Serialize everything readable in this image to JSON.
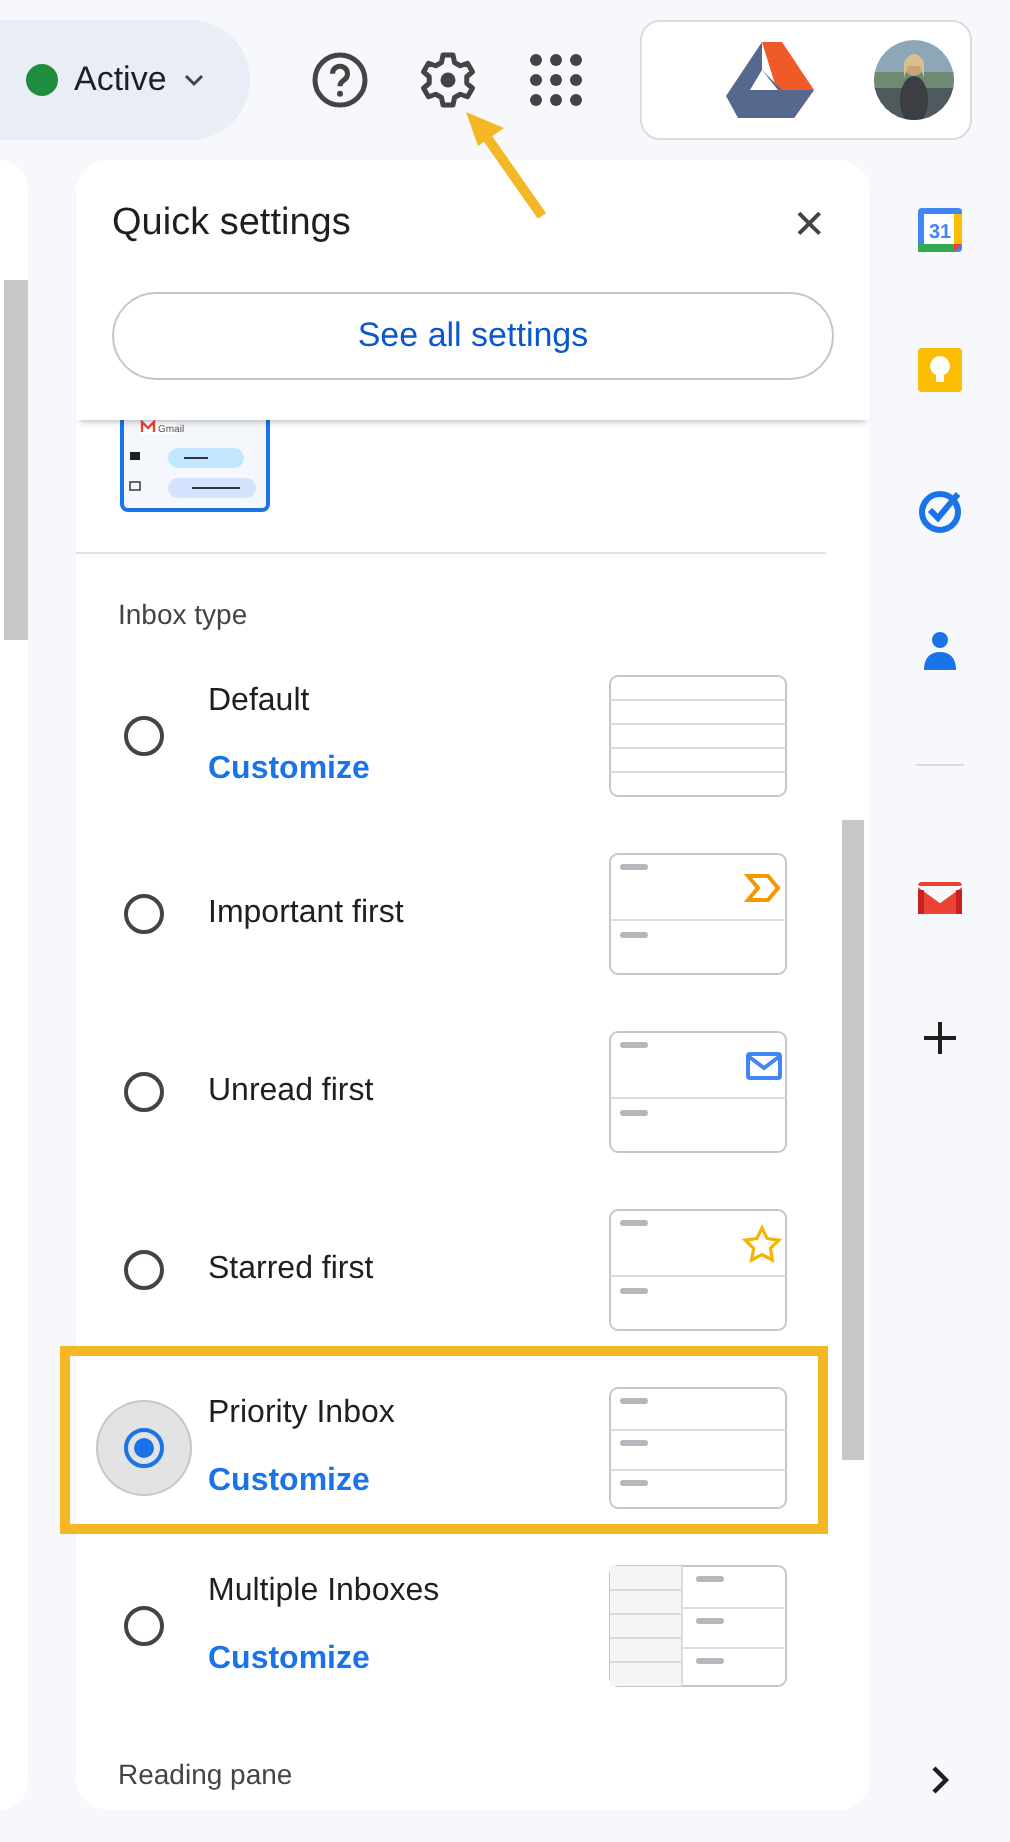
{
  "topbar": {
    "status": {
      "label": "Active",
      "color": "#1e8e3e"
    }
  },
  "quick_settings": {
    "title": "Quick settings",
    "close": "✕",
    "see_all_button": "See all settings",
    "density_thumbnail": {
      "brand": "Gmail"
    },
    "sections": [
      {
        "title": "Inbox type",
        "options": [
          {
            "label": "Default",
            "link": "Customize",
            "selected": false,
            "kind": "lines",
            "highlighted": false
          },
          {
            "label": "Important first",
            "selected": false,
            "kind": "important",
            "highlighted": false
          },
          {
            "label": "Unread first",
            "selected": false,
            "kind": "unread",
            "highlighted": false
          },
          {
            "label": "Starred first",
            "selected": false,
            "kind": "starred",
            "highlighted": false
          },
          {
            "label": "Priority Inbox",
            "link": "Customize",
            "selected": true,
            "kind": "sections",
            "highlighted": true
          },
          {
            "label": "Multiple Inboxes",
            "link": "Customize",
            "selected": false,
            "kind": "multiple",
            "highlighted": false
          }
        ]
      },
      {
        "title": "Reading pane"
      }
    ]
  },
  "side_rail": {
    "calendar_day": "31"
  }
}
